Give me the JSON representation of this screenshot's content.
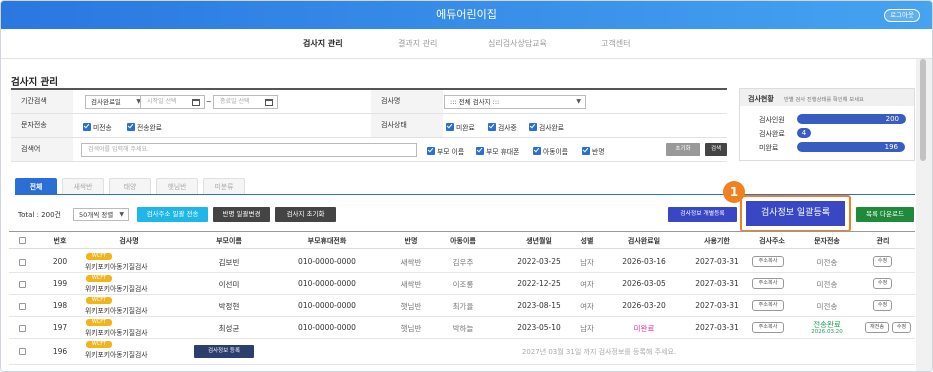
{
  "app": {
    "title": "에듀어린이집",
    "logout": "로그아웃"
  },
  "nav": [
    "검사지 관리",
    "결과지 관리",
    "심리검사상담교육",
    "고객센터"
  ],
  "page_title": "검사지 관리",
  "filter": {
    "period_label": "기간검색",
    "period_select": "검사완료일",
    "start_placeholder": "시작일 선택",
    "tilde": "~",
    "end_placeholder": "종료일 선택",
    "testname_label": "검사명",
    "testname_select": "::: 전체 검사지 :::",
    "sms_label": "문자전송",
    "sms_options": [
      "미전송",
      "전송완료"
    ],
    "status_label": "검사상태",
    "status_options": [
      "미완료",
      "검사중",
      "검사완료"
    ],
    "search_label": "검색어",
    "search_placeholder": "검색어를 입력해 주세요.",
    "search_fields": [
      "부모 이름",
      "부모 휴대폰",
      "아동이름",
      "반명"
    ],
    "reset_btn": "초기화",
    "search_btn": "검색"
  },
  "status_panel": {
    "title": "검사현황",
    "hint": "반별 검사 진행상태를 확인해 보세요",
    "rows": [
      {
        "label": "검사인원",
        "value": "200",
        "fill": 1.0
      },
      {
        "label": "검사완료",
        "value": "4",
        "fill": 0.02
      },
      {
        "label": "미완료",
        "value": "196",
        "fill": 0.98
      }
    ]
  },
  "tabs": [
    "전체",
    "새싹반",
    "태양",
    "햇님반",
    "미분류"
  ],
  "toolbar": {
    "total": "Total : 200건",
    "per_page": "50개씩 정렬",
    "send_all": "검사주소 일괄 전송",
    "class_change": "반명 일괄변경",
    "reset_tests": "검사지 초기화",
    "register_single": "검사정보 개별등록",
    "register_bulk": "검사정보 일괄등록",
    "download": "목록 다운로드",
    "callout_number": "1"
  },
  "table": {
    "headers": [
      "번호",
      "검사명",
      "부모이름",
      "부모휴대전화",
      "반명",
      "아동이름",
      "생년월일",
      "성별",
      "검사완료일",
      "사용기한",
      "검사주소",
      "문자전송",
      "관리"
    ],
    "rows": [
      {
        "no": "200",
        "tag": "WCFT",
        "test": "위키포키아동기질검사",
        "parent": "김보빈",
        "phone": "010-0000-0000",
        "class": "새싹반",
        "child": "김우주",
        "birth": "2022-03-25",
        "sex": "남자",
        "done": "2026-03-16",
        "expire": "2027-03-31",
        "addr_btn": "주소복사",
        "sms": "미전송",
        "sms_date": "",
        "manage": [
          "수정"
        ]
      },
      {
        "no": "199",
        "tag": "WCFT",
        "test": "위키포키아동기질검사",
        "parent": "이선미",
        "phone": "010-0000-0000",
        "class": "새싹반",
        "child": "이조롱",
        "birth": "2022-12-25",
        "sex": "여자",
        "done": "2026-03-05",
        "expire": "2027-03-31",
        "addr_btn": "주소복사",
        "sms": "미전송",
        "sms_date": "",
        "manage": [
          "수정"
        ]
      },
      {
        "no": "198",
        "tag": "WCFT",
        "test": "위키포키아동기질검사",
        "parent": "박정현",
        "phone": "010-0000-0000",
        "class": "햇님반",
        "child": "최가율",
        "birth": "2023-08-15",
        "sex": "여자",
        "done": "2026-03-20",
        "expire": "2027-03-31",
        "addr_btn": "주소복사",
        "sms": "미전송",
        "sms_date": "",
        "manage": [
          "수정"
        ]
      },
      {
        "no": "197",
        "tag": "WCFT",
        "test": "위키포키아동기질검사",
        "parent": "최성균",
        "phone": "010-0000-0000",
        "class": "햇님반",
        "child": "박하늘",
        "birth": "2023-05-10",
        "sex": "남자",
        "done": "미완료",
        "expire": "2027-03-31",
        "addr_btn": "주소복사",
        "sms": "전송완료",
        "sms_date": "2026.03.20",
        "manage": [
          "재전송",
          "수정"
        ]
      }
    ],
    "last_row": {
      "no": "196",
      "tag": "WCFT",
      "test": "위키포키아동기질검사",
      "register_btn": "검사정보 등록",
      "notice": "2027년 03월 31일 까지 검사정보를 등록해 주세요."
    }
  },
  "colors": {
    "header": "#2a77e0",
    "accent": "#2b6fd6",
    "bulk_button": "#3a47c4",
    "callout": "#f08020",
    "wcft_tag": "#f3b419",
    "status_bar": "#3a5bbf"
  }
}
